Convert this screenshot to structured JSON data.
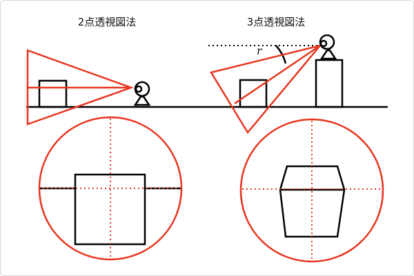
{
  "diagram": {
    "title_two_point": "2点透視図法",
    "title_three_point": "3点透視図法",
    "angle_symbol": "r"
  },
  "colors": {
    "accent_red": "#e8351f",
    "line_black": "#000000",
    "background": "#ffffff"
  }
}
